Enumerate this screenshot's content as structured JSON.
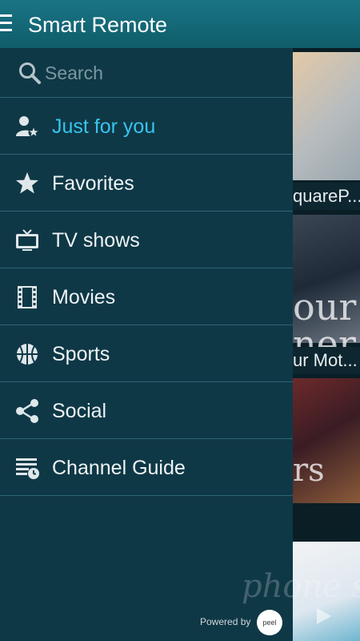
{
  "app": {
    "title": "Smart Remote"
  },
  "search": {
    "placeholder": "Search"
  },
  "menu": [
    {
      "label": "Just for you",
      "icon": "user-star-icon",
      "active": true
    },
    {
      "label": "Favorites",
      "icon": "star-icon"
    },
    {
      "label": "TV shows",
      "icon": "tv-icon"
    },
    {
      "label": "Movies",
      "icon": "film-icon"
    },
    {
      "label": "Sports",
      "icon": "basketball-icon"
    },
    {
      "label": "Social",
      "icon": "share-icon"
    },
    {
      "label": "Channel Guide",
      "icon": "guide-clock-icon"
    }
  ],
  "background_tiles": [
    {
      "caption": "quareP..."
    },
    {
      "caption": "ur Mot...",
      "overlay": "our\nner"
    },
    {
      "caption": "",
      "overlay": "rs"
    },
    {
      "caption": ""
    }
  ],
  "footer": {
    "powered_by": "Powered by",
    "brand": "peel"
  },
  "watermark": "phone scoop",
  "colors": {
    "accent": "#37c4ec",
    "appbar": "#13697a",
    "drawer": "#0f3846",
    "divider": "#2e6474"
  }
}
